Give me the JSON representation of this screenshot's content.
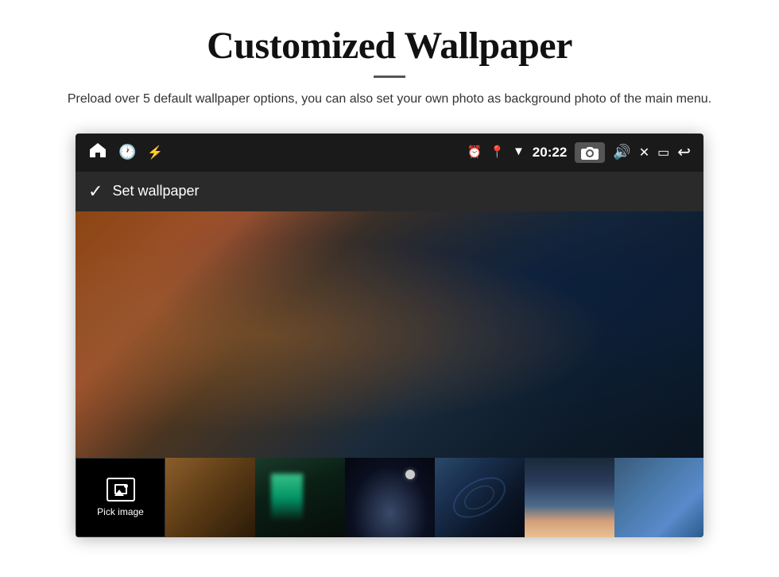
{
  "header": {
    "title": "Customized Wallpaper",
    "subtitle": "Preload over 5 default wallpaper options, you can also set your own photo as background photo of the main menu."
  },
  "status_bar": {
    "time": "20:22",
    "icons": [
      "home",
      "alarm",
      "usb",
      "clock",
      "location",
      "wifi",
      "camera",
      "volume",
      "close",
      "window",
      "back"
    ]
  },
  "action_bar": {
    "check_icon": "✓",
    "label": "Set wallpaper"
  },
  "thumbnails": [
    {
      "id": "pick",
      "label": "Pick image"
    },
    {
      "id": "thumb1"
    },
    {
      "id": "thumb2"
    },
    {
      "id": "thumb3"
    },
    {
      "id": "thumb4"
    },
    {
      "id": "thumb5"
    },
    {
      "id": "thumb6"
    },
    {
      "id": "thumb7"
    }
  ]
}
